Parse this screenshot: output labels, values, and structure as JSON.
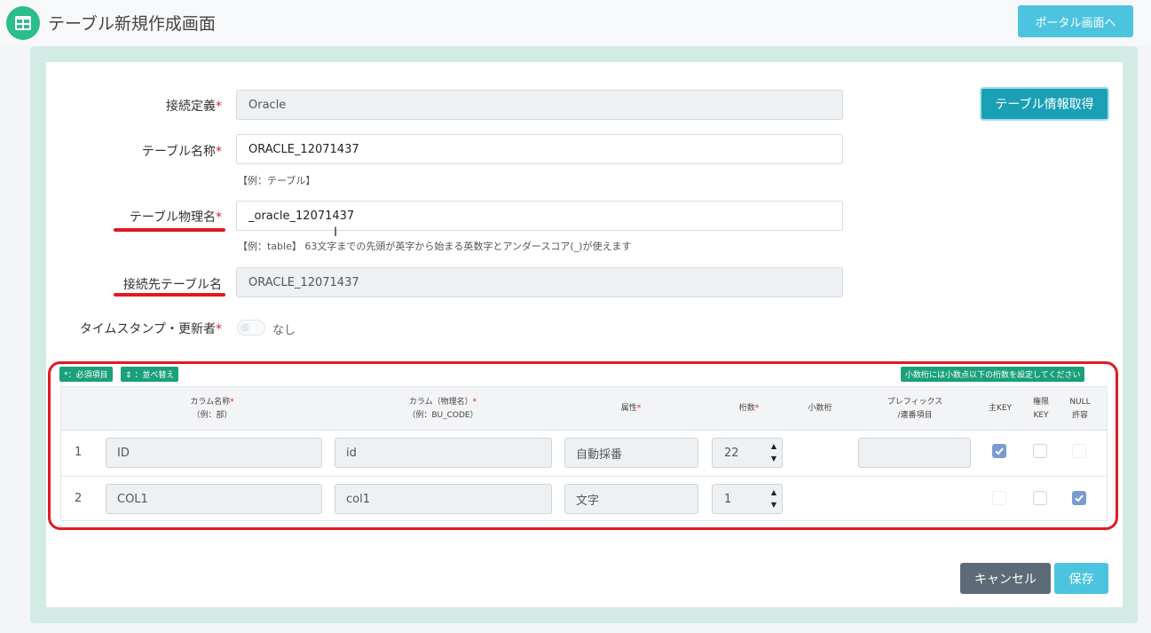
{
  "header": {
    "title": "テーブル新規作成画面",
    "portal_button": "ポータル画面へ",
    "icon": "table-grid-icon",
    "accent": "#2bbd8c"
  },
  "form": {
    "connection": {
      "label": "接続定義",
      "required": "*",
      "value": "Oracle"
    },
    "table_name": {
      "label": "テーブル名称",
      "required": "*",
      "value": "ORACLE_12071437",
      "hint": "【例：テーブル】"
    },
    "physical_name": {
      "label": "テーブル物理名",
      "required": "*",
      "value": "_oracle_12071437",
      "hint": "【例：table】 63文字までの先頭が英字から始まる英数字とアンダースコア(_)が使えます"
    },
    "target_table": {
      "label": "接続先テーブル名",
      "value": "ORACLE_12071437"
    },
    "timestamp": {
      "label": "タイムスタンプ・更新者",
      "required": "*",
      "toggle_text": "なし",
      "enabled": false
    },
    "info_button": "テーブル情報取得"
  },
  "badges": {
    "required": "*：必須項目",
    "sort": "⇕ ：並べ替え",
    "decimal_note": "小数桁には小数点以下の桁数を設定してください"
  },
  "table": {
    "headers": {
      "col_name": {
        "line1": "カラム名称",
        "req": "*",
        "line2": "（例：部）"
      },
      "col_phys": {
        "line1": "カラム（物理名）",
        "req": "*",
        "line2": "（例：BU_CODE）"
      },
      "attr": {
        "line1": "属性",
        "req": "*"
      },
      "digits": {
        "line1": "桁数",
        "req": "*"
      },
      "decimal": {
        "line1": "小数桁"
      },
      "prefix": {
        "line1": "プレフィックス",
        "line2": "/連番項目"
      },
      "pk": {
        "line1": "主KEY"
      },
      "perm": {
        "line1": "権限",
        "line2": "KEY"
      },
      "null": {
        "line1": "NULL",
        "line2": "許容"
      }
    },
    "rows": [
      {
        "num": "1",
        "name": "ID",
        "phys": "id",
        "attr": "自動採番",
        "digits": "22",
        "decimal": "",
        "prefix": "",
        "pk": true,
        "perm": false,
        "null": false
      },
      {
        "num": "2",
        "name": "COL1",
        "phys": "col1",
        "attr": "文字",
        "digits": "1",
        "decimal": "",
        "pk": false,
        "perm": false,
        "null": true
      }
    ]
  },
  "footer": {
    "cancel": "キャンセル",
    "save": "保存"
  },
  "colors": {
    "accent": "#4cc4df",
    "highlight": "#e01a22",
    "badge": "#1aa07a",
    "panel": "#d2ece5"
  }
}
